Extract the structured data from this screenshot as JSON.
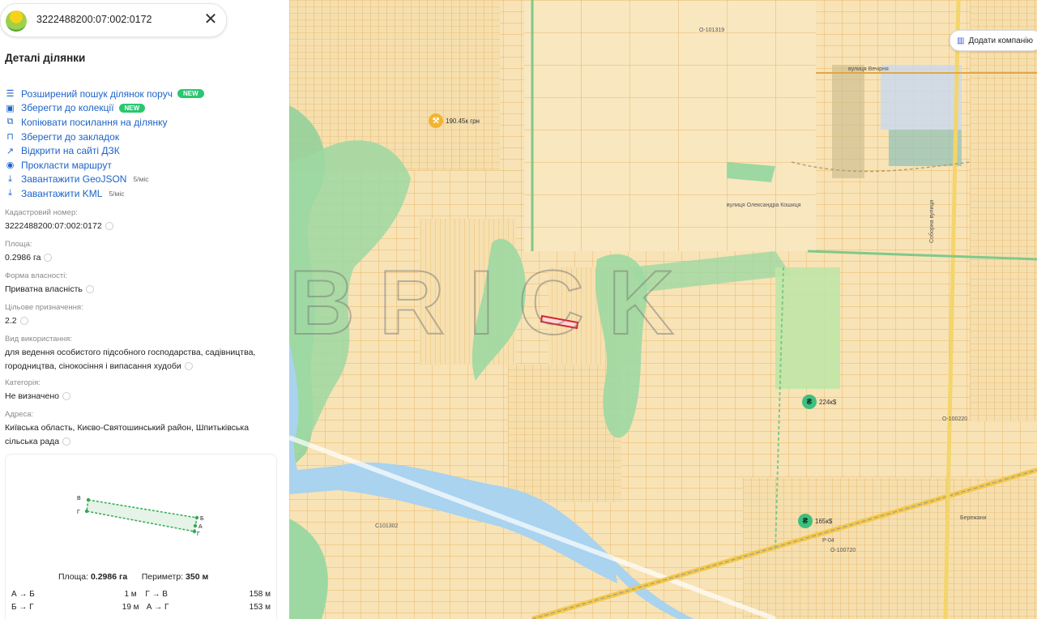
{
  "search": {
    "query": "3222488200:07:002:0172"
  },
  "panel": {
    "title": "Деталі ділянки",
    "actions": [
      {
        "label": "Розширений пошук ділянок поруч",
        "icon": "filter-icon",
        "badge": "NEW",
        "badge_type": "new"
      },
      {
        "label": "Зберегти до колекції",
        "icon": "collection-icon",
        "badge": "NEW",
        "badge_type": "new"
      },
      {
        "label": "Копіювати посилання на ділянку",
        "icon": "link-icon",
        "badge": "",
        "badge_type": ""
      },
      {
        "label": "Зберегти до закладок",
        "icon": "bookmark-icon",
        "badge": "",
        "badge_type": ""
      },
      {
        "label": "Відкрити на сайті ДЗК",
        "icon": "external-link-icon",
        "badge": "",
        "badge_type": ""
      },
      {
        "label": "Прокласти маршрут",
        "icon": "location-pin-icon",
        "badge": "",
        "badge_type": ""
      },
      {
        "label": "Завантажити GeoJSON",
        "icon": "download-icon",
        "badge": "5/міс",
        "badge_type": "sub"
      },
      {
        "label": "Завантажити KML",
        "icon": "download-icon",
        "badge": "5/міс",
        "badge_type": "sub"
      }
    ],
    "fields": {
      "cadastral": {
        "label": "Кадастровий номер:",
        "value": "3222488200:07:002:0172"
      },
      "area": {
        "label": "Площа:",
        "value": "0.2986 га"
      },
      "ownership": {
        "label": "Форма власності:",
        "value": "Приватна власність"
      },
      "purpose": {
        "label": "Цільове призначення:",
        "value": "2.2"
      },
      "usage": {
        "label": "Вид використання:",
        "value_line1": "для ведення особистого підсобного господарства, садівництва,",
        "value_line2": "городництва, сінокосіння і випасання худоби"
      },
      "category": {
        "label": "Категорія:",
        "value": "Не визначено"
      },
      "address": {
        "label": "Адреса:",
        "value_line1": "Київська область, Києво-Святошинський район, Шпитьківська",
        "value_line2": "сільська рада"
      }
    },
    "plot": {
      "vertex_labels": [
        "В",
        "Г",
        "Б",
        "А",
        "Г"
      ],
      "area_label": "Площа:",
      "area_value": "0.2986 га",
      "perimeter_label": "Периметр:",
      "perimeter_value": "350 м",
      "sides": [
        {
          "from": "А → Б",
          "mid": "1 м",
          "to": "Г → В",
          "length": "158 м"
        },
        {
          "from": "Б → Г",
          "mid": "19 м",
          "to": "А → Г",
          "length": "153 м"
        }
      ]
    }
  },
  "map": {
    "add_button": "Додати компанію",
    "watermark": "BRICK",
    "prices": [
      {
        "text": "190.45к грн",
        "icon": "hammer-icon",
        "color": "#f2b431"
      },
      {
        "text": "224к$",
        "icon": "hryvnia-icon",
        "color": "#3fbf7f"
      },
      {
        "text": "165к$",
        "icon": "hryvnia-icon",
        "color": "#3fbf7f"
      }
    ],
    "streets": [
      "О-101319",
      "вулиця Вечірня",
      "вулиця Олександра Кошиця",
      "Соборна вулиця",
      "О-100220",
      "О-100720",
      "С101302",
      "Р-04",
      "Бережани"
    ]
  }
}
